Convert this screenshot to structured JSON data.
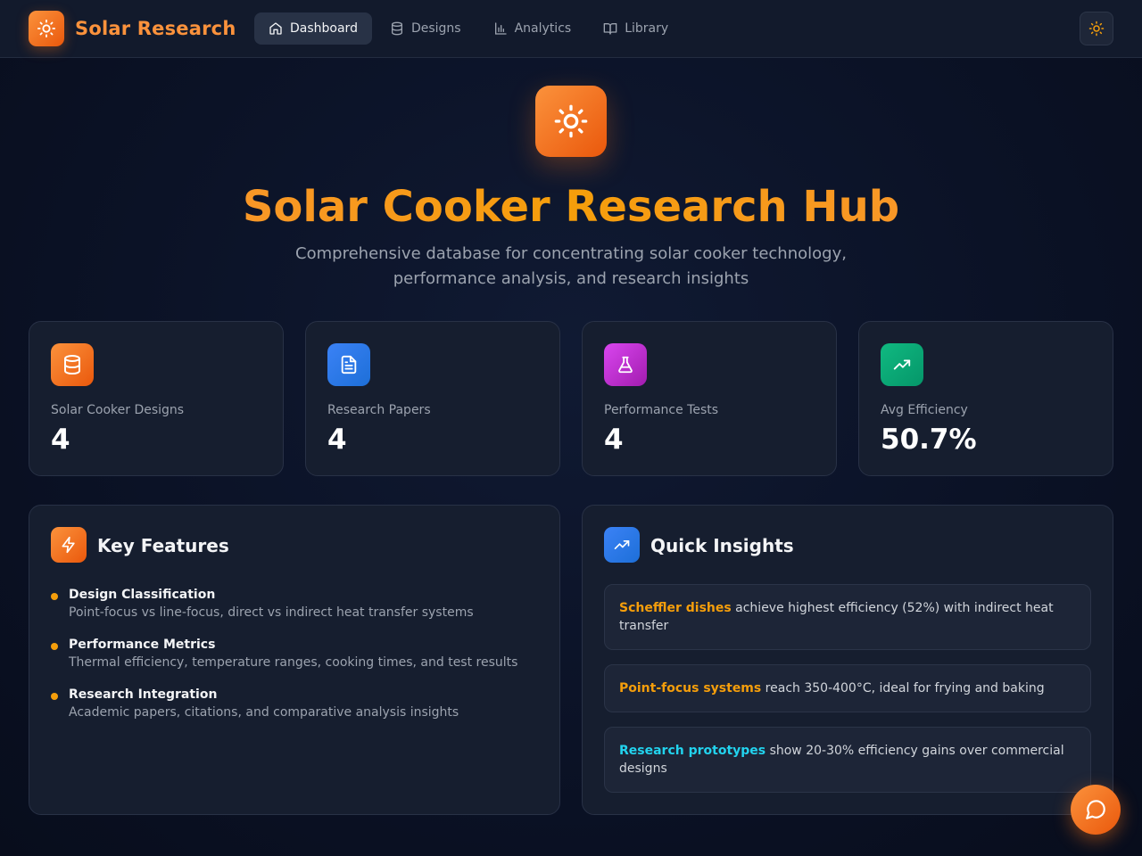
{
  "brand": {
    "name": "Solar Research",
    "accent": "#f97316"
  },
  "nav": {
    "items": [
      {
        "label": "Dashboard",
        "icon": "home-icon",
        "active": true
      },
      {
        "label": "Designs",
        "icon": "database-icon",
        "active": false
      },
      {
        "label": "Analytics",
        "icon": "bar-chart-icon",
        "active": false
      },
      {
        "label": "Library",
        "icon": "book-open-icon",
        "active": false
      }
    ],
    "theme_toggle_icon": "sun-icon"
  },
  "hero": {
    "icon": "sun-icon",
    "title": "Solar Cooker Research Hub",
    "subtitle": "Comprehensive database for concentrating solar cooker technology, performance analysis, and research insights"
  },
  "stats": [
    {
      "label": "Solar Cooker Designs",
      "value": "4",
      "icon": "database-icon",
      "color": "#f97316"
    },
    {
      "label": "Research Papers",
      "value": "4",
      "icon": "file-text-icon",
      "color": "#3b82f6"
    },
    {
      "label": "Performance Tests",
      "value": "4",
      "icon": "flask-icon",
      "color": "#c026d3"
    },
    {
      "label": "Avg Efficiency",
      "value": "50.7%",
      "icon": "trending-up-icon",
      "color": "#10b981"
    }
  ],
  "features": {
    "title": "Key Features",
    "icon": "zap-icon",
    "items": [
      {
        "title": "Design Classification",
        "desc": "Point-focus vs line-focus, direct vs indirect heat transfer systems"
      },
      {
        "title": "Performance Metrics",
        "desc": "Thermal efficiency, temperature ranges, cooking times, and test results"
      },
      {
        "title": "Research Integration",
        "desc": "Academic papers, citations, and comparative analysis insights"
      }
    ]
  },
  "insights": {
    "title": "Quick Insights",
    "icon": "trending-up-icon",
    "items": [
      {
        "highlight": "Scheffler dishes",
        "text": " achieve highest efficiency (52%) with indirect heat transfer",
        "color": "#f59e0b"
      },
      {
        "highlight": "Point-focus systems",
        "text": " reach 350-400°C, ideal for frying and baking",
        "color": "#f59e0b"
      },
      {
        "highlight": "Research prototypes",
        "text": " show 20-30% efficiency gains over commercial designs",
        "color": "#22d3ee"
      }
    ]
  },
  "chat": {
    "icon": "message-circle-icon"
  }
}
